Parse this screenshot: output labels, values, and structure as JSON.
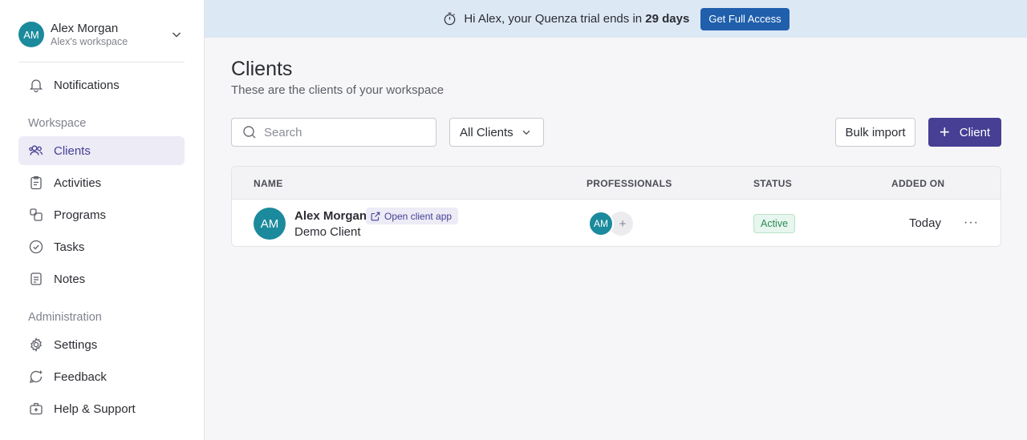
{
  "profile": {
    "initials": "AM",
    "name": "Alex Morgan",
    "workspace": "Alex's workspace"
  },
  "nav": {
    "notifications": "Notifications",
    "workspace_label": "Workspace",
    "workspace_items": [
      {
        "label": "Clients",
        "icon": "users-icon",
        "active": true
      },
      {
        "label": "Activities",
        "icon": "clipboard-icon"
      },
      {
        "label": "Programs",
        "icon": "programs-icon"
      },
      {
        "label": "Tasks",
        "icon": "check-circle-icon"
      },
      {
        "label": "Notes",
        "icon": "notes-icon"
      }
    ],
    "admin_label": "Administration",
    "admin_items": [
      {
        "label": "Settings",
        "icon": "gear-icon"
      },
      {
        "label": "Feedback",
        "icon": "feedback-icon"
      },
      {
        "label": "Help & Support",
        "icon": "help-icon"
      }
    ]
  },
  "banner": {
    "text_prefix": "Hi Alex, your Quenza trial ends in ",
    "days": "29 days",
    "cta": "Get Full Access"
  },
  "page": {
    "title": "Clients",
    "subtitle": "These are the clients of your workspace"
  },
  "toolbar": {
    "search_placeholder": "Search",
    "filter_value": "All Clients",
    "bulk_import": "Bulk import",
    "add_client": "Client"
  },
  "table": {
    "headers": {
      "name": "NAME",
      "professionals": "PROFESSIONALS",
      "status": "STATUS",
      "added_on": "ADDED ON"
    },
    "rows": [
      {
        "initials": "AM",
        "name": "Alex Morgan",
        "open_link": "Open client app",
        "subtitle": "Demo Client",
        "professional_initials": "AM",
        "add_symbol": "+",
        "status": "Active",
        "added_on": "Today",
        "more": "···"
      }
    ]
  },
  "colors": {
    "accent": "#463f94",
    "avatar": "#1b8a9c",
    "banner_bg": "#dde8f5",
    "cta": "#1f5fac",
    "status_active": "#2e8b57"
  }
}
